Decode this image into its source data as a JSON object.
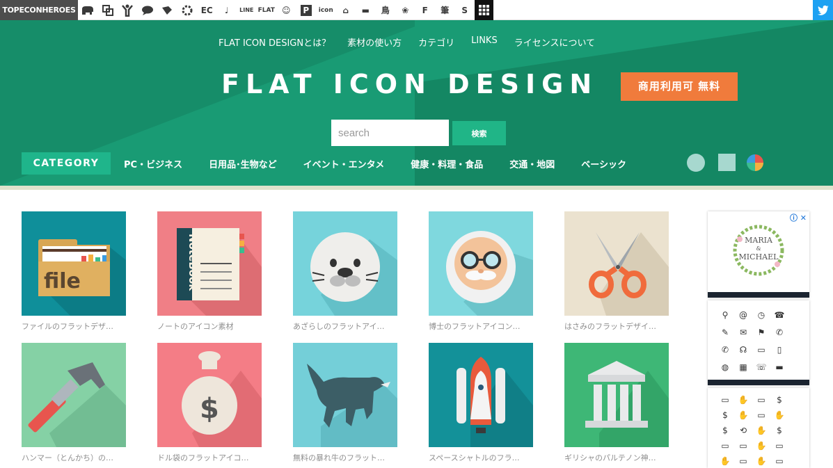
{
  "topbar": {
    "brand": "TOPECONHEROES",
    "site_icons": [
      "EC",
      "♩",
      "LINE",
      "FLAT",
      "☺",
      "P",
      "icon",
      "⌂",
      "▬",
      "鳥",
      "❀",
      "F",
      "筆",
      "S"
    ]
  },
  "header": {
    "nav": [
      "FLAT ICON DESIGNとは？",
      "素材の使い方",
      "カテゴリ",
      "LINKS",
      "ライセンスについて"
    ],
    "logo": "FLAT ICON DESIGN",
    "badge": "商用利用可 無料",
    "search_placeholder": "search",
    "search_button": "検索",
    "category_label": "CATEGORY",
    "categories": [
      "PC・ビジネス",
      "日用品･生物など",
      "イベント・エンタメ",
      "健康・料理・食品",
      "交通・地図",
      "ベーシック"
    ]
  },
  "items": [
    {
      "caption": "ファイルのフラットデザ…",
      "bg": "#0f8f9a",
      "icon": "folder-icon"
    },
    {
      "caption": "ノートのアイコン素材",
      "bg": "#f07f86",
      "icon": "notebook-icon"
    },
    {
      "caption": "あざらしのフラットアイ…",
      "bg": "#76d3db",
      "icon": "seal-icon"
    },
    {
      "caption": "博士のフラットアイコン…",
      "bg": "#7fd8de",
      "icon": "professor-icon"
    },
    {
      "caption": "はさみのフラットデザイ…",
      "bg": "#ebe2cf",
      "icon": "scissors-icon"
    },
    {
      "caption": "ハンマー（とんかち）の…",
      "bg": "#85d1a5",
      "icon": "hammer-icon"
    },
    {
      "caption": "ドル袋のフラットアイコ…",
      "bg": "#f47d86",
      "icon": "money-bag-icon"
    },
    {
      "caption": "無料の暴れ牛のフラット…",
      "bg": "#74cfd8",
      "icon": "bull-icon"
    },
    {
      "caption": "スペースシャトルのフラ…",
      "bg": "#139199",
      "icon": "space-shuttle-icon"
    },
    {
      "caption": "ギリシャのパルテノン神…",
      "bg": "#3eb776",
      "icon": "parthenon-icon"
    }
  ],
  "ads": {
    "ad1_title_line1": "MARIA",
    "ad1_title_amp": "&",
    "ad1_title_line2": "MICHAEL",
    "close": "ⓘ ✕",
    "ad2_icons": [
      "⚲",
      "@",
      "◷",
      "☎",
      "✎",
      "✉",
      "⚑",
      "✆",
      "✆",
      "☊",
      "▭",
      "▯",
      "◍",
      "▦",
      "☏",
      "▬"
    ],
    "ad3_icons": [
      "▭",
      "✋",
      "▭",
      "$",
      "$",
      "✋",
      "▭",
      "✋",
      "$",
      "⟲",
      "✋",
      "$",
      "▭",
      "▭",
      "✋",
      "▭",
      "✋",
      "▭",
      "✋",
      "▭"
    ]
  }
}
